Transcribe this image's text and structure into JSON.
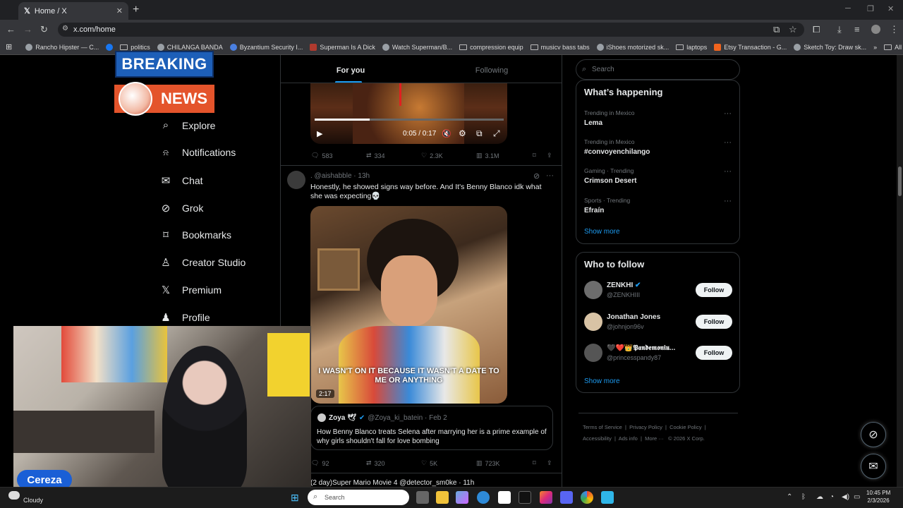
{
  "browser": {
    "tab_title": "Home / X",
    "tab_close": "✕",
    "new_tab": "+",
    "url": "x.com/home",
    "bookmarks": [
      {
        "label": "Rancho Hipster — C...",
        "kind": "site"
      },
      {
        "label": "",
        "kind": "facebook"
      },
      {
        "label": "politics",
        "kind": "folder"
      },
      {
        "label": "CHILANGA BANDA",
        "kind": "site"
      },
      {
        "label": "Byzantium Security I...",
        "kind": "site"
      },
      {
        "label": "Superman Is A Dick",
        "kind": "site"
      },
      {
        "label": "Watch Superman/B...",
        "kind": "site"
      },
      {
        "label": "compression equip",
        "kind": "folder"
      },
      {
        "label": "musicv bass tabs",
        "kind": "folder"
      },
      {
        "label": "iShoes motorized sk...",
        "kind": "site"
      },
      {
        "label": "laptops",
        "kind": "folder"
      },
      {
        "label": "Etsy Transaction - G...",
        "kind": "site"
      },
      {
        "label": "Sketch Toy: Draw sk...",
        "kind": "site"
      }
    ],
    "all_bookmarks": "All Bookmarks"
  },
  "overlay": {
    "breaking": "BREAKING",
    "news": "NEWS",
    "streamer_name": "Cereza"
  },
  "nav": [
    {
      "label": "Explore",
      "icon": "search-icon",
      "glyph": "⌕"
    },
    {
      "label": "Notifications",
      "icon": "bell-icon",
      "glyph": "🔔"
    },
    {
      "label": "Chat",
      "icon": "mail-icon",
      "glyph": "✉"
    },
    {
      "label": "Grok",
      "icon": "grok-icon",
      "glyph": "⊘"
    },
    {
      "label": "Bookmarks",
      "icon": "bookmark-icon",
      "glyph": "⚑"
    },
    {
      "label": "Creator Studio",
      "icon": "creator-icon",
      "glyph": "♙"
    },
    {
      "label": "Premium",
      "icon": "x-icon",
      "glyph": "𝕏"
    },
    {
      "label": "Profile",
      "icon": "person-icon",
      "glyph": "♟"
    }
  ],
  "feed": {
    "tabs": {
      "for_you": "For you",
      "following": "Following"
    },
    "video1": {
      "time": "0:05 / 0:17",
      "progress": 0.29
    },
    "tweet1_stats": {
      "replies": "583",
      "retweets": "334",
      "likes": "2.3K",
      "views": "3.1M"
    },
    "tweet2": {
      "handle_line": ". @aishabble · 13h",
      "text": "Honestly, he showed signs way before. And It's Benny Blanco idk what she was expecting💀",
      "caption": "I WASN'T ON IT BECAUSE IT WASN'T A DATE TO ME OR ANYTHING",
      "duration": "2:17",
      "quote": {
        "name": "Zoya 🕊",
        "meta": "@Zoya_ki_batein · Feb 2",
        "text": "How Benny Blanco treats Selena after marrying her is a prime example of why girls shouldn't fall for love bombing"
      },
      "stats": {
        "replies": "92",
        "retweets": "320",
        "likes": "5K",
        "views": "723K"
      }
    },
    "tweet3_head": "(2 day)Super Mario Movie 4 @detector_sm0ke · 11h"
  },
  "right": {
    "search_placeholder": "Search",
    "happening_title": "What’s happening",
    "trends": [
      {
        "context": "Trending in Mexico",
        "name": "Lema"
      },
      {
        "context": "Trending in Mexico",
        "name": "#convoyenchilango"
      },
      {
        "context": "Gaming · Trending",
        "name": "Crimson Desert"
      },
      {
        "context": "Sports · Trending",
        "name": "Efraín"
      }
    ],
    "trend_more": "···",
    "show_more": "Show more",
    "who_title": "Who to follow",
    "follow_suggestions": [
      {
        "name": "ZENKHI",
        "handle": "@ZENKHIII",
        "verified": true
      },
      {
        "name": "Jonathan Jones",
        "handle": "@johnjon96v",
        "verified": false
      },
      {
        "name": "🖤❤️👑𝕻𝖆𝖓𝖉𝖊𝖒𝖔𝖓𝖎𝖚...",
        "handle": "@princesspandy87",
        "verified": false
      }
    ],
    "follow_label": "Follow",
    "footer": [
      "Terms of Service",
      "Privacy Policy",
      "Cookie Policy",
      "Accessibility",
      "Ads info",
      "More ···",
      "© 2026 X Corp."
    ]
  },
  "taskbar": {
    "weather": "Cloudy",
    "search_placeholder": "Search",
    "time": "10:45 PM",
    "date": "2/3/2026"
  },
  "colors": {
    "accent": "#1d9bf0",
    "breaking_bg": "#1d5fb8",
    "news_bg": "#e4542b",
    "cereza_bg": "#1a5fd6"
  }
}
